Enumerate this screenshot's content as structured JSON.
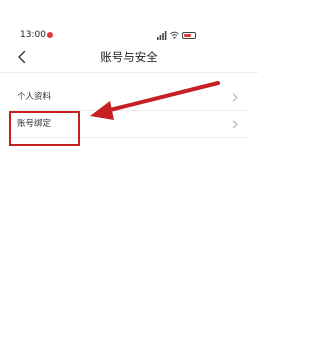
{
  "status_bar": {
    "time": "13:00",
    "icons": [
      "notification-dot-icon",
      "signal-icon",
      "wifi-icon",
      "battery-icon"
    ],
    "notification_color": "#e03a3a"
  },
  "nav": {
    "back_icon": "chevron-left-icon",
    "title": "账号与安全"
  },
  "settings": {
    "items": [
      {
        "label": "个人资料",
        "icon": "chevron-right-icon"
      },
      {
        "label": "账号绑定",
        "icon": "chevron-right-icon"
      }
    ]
  },
  "annotation": {
    "color": "#c62020",
    "target": "账号绑定"
  }
}
